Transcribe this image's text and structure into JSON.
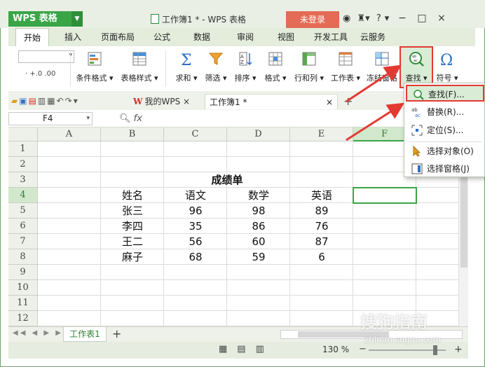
{
  "app": {
    "name": "WPS 表格",
    "document_title": "工作簿1 * - WPS 表格",
    "login_button": "未登录",
    "help_icon": "?",
    "window_controls": [
      "−",
      "□",
      "×"
    ]
  },
  "menu": {
    "tabs": [
      "开始",
      "插入",
      "页面布局",
      "公式",
      "数据",
      "审阅",
      "视图",
      "开发工具",
      "云服务"
    ],
    "active_tab": "开始"
  },
  "ribbon": {
    "small_format": "· +.0 .00",
    "buttons": [
      {
        "label": "条件格式 ▾",
        "icon": "conditional-format-icon"
      },
      {
        "label": "表格样式 ▾",
        "icon": "table-style-icon"
      },
      {
        "label": "求和 ▾",
        "icon": "sum-icon"
      },
      {
        "label": "筛选 ▾",
        "icon": "filter-icon"
      },
      {
        "label": "排序 ▾",
        "icon": "sort-icon"
      },
      {
        "label": "格式 ▾",
        "icon": "format-icon"
      },
      {
        "label": "行和列 ▾",
        "icon": "row-col-icon"
      },
      {
        "label": "工作表 ▾",
        "icon": "worksheet-icon"
      },
      {
        "label": "冻结窗格",
        "icon": "freeze-icon"
      },
      {
        "label": "查找 ▾",
        "icon": "find-icon"
      },
      {
        "label": "符号 ▾",
        "icon": "symbol-icon"
      }
    ]
  },
  "doc_tabs": {
    "wps_tab": "我的WPS",
    "book_tab": "工作簿1 *",
    "close": "×",
    "add": "+"
  },
  "formula_bar": {
    "cell_ref": "F4",
    "fx": "fx",
    "value": ""
  },
  "sheet": {
    "columns": [
      "A",
      "B",
      "C",
      "D",
      "E",
      "F"
    ],
    "rows": [
      "1",
      "2",
      "3",
      "4",
      "5",
      "6",
      "7",
      "8",
      "9",
      "10",
      "11",
      "12"
    ],
    "selected_column": "F",
    "selected_row": "4",
    "title": "成绩单",
    "headers": [
      "姓名",
      "语文",
      "数学",
      "英语"
    ],
    "data": [
      [
        "张三",
        "96",
        "98",
        "89"
      ],
      [
        "李四",
        "35",
        "86",
        "76"
      ],
      [
        "王二",
        "56",
        "60",
        "87"
      ],
      [
        "麻子",
        "68",
        "59",
        "6"
      ]
    ]
  },
  "sheet_tabs": {
    "active": "工作表1",
    "add": "+"
  },
  "status": {
    "zoom": "130 %",
    "minus": "−",
    "plus": "+"
  },
  "find_menu": {
    "items": [
      {
        "label": "查找(F)...",
        "icon": "find-icon"
      },
      {
        "label": "替换(R)...",
        "icon": "replace-icon"
      },
      {
        "label": "定位(S)...",
        "icon": "goto-icon"
      },
      {
        "label": "选择对象(O)",
        "icon": "select-object-icon"
      },
      {
        "label": "选择窗格(J)",
        "icon": "selection-pane-icon"
      }
    ]
  },
  "watermark": {
    "brand": "搜狗指南",
    "url": "zhinan.sogou.com"
  },
  "colors": {
    "accent_green": "#3aa547",
    "highlight_red": "#e23a32",
    "login_orange": "#e46b55"
  }
}
